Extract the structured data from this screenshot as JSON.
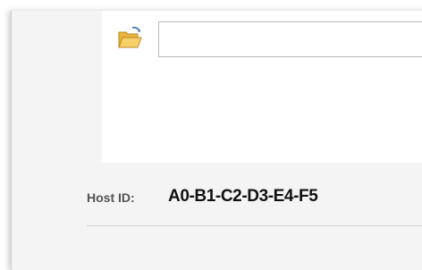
{
  "file_picker": {
    "browse_icon": "open-folder-icon",
    "path_value": "",
    "path_placeholder": ""
  },
  "host": {
    "label": "Host ID:",
    "value": "A0-B1-C2-D3-E4-F5"
  },
  "colors": {
    "window_bg": "#f4f4f4",
    "panel_bg": "#ffffff",
    "folder_yellow": "#f2c14e",
    "folder_outline": "#b88a1e"
  }
}
